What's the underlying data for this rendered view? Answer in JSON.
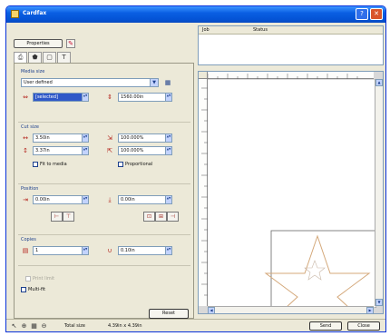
{
  "window": {
    "title": "Cardfax"
  },
  "hint": "",
  "left": {
    "properties_label": "Properties",
    "tabs": [
      {
        "name": "tab-print",
        "glyph": "🖶"
      },
      {
        "name": "tab-shape",
        "glyph": "⬟"
      },
      {
        "name": "tab-frame",
        "glyph": "▢"
      },
      {
        "name": "tab-text",
        "glyph": "T"
      }
    ],
    "media": {
      "label": "Media size",
      "select_value": "User defined",
      "width_value": "[selected]",
      "height_value": "1560.00in"
    },
    "cutsize": {
      "label": "Cut size",
      "width_value": "3.50in",
      "width_pct": "100.000%",
      "height_value": "3.37in",
      "height_pct": "100.000%",
      "fit_label": "Fit to media",
      "proportional_label": "Proportional"
    },
    "position": {
      "label": "Position",
      "x_value": "0.00in",
      "y_value": "0.00in"
    },
    "copies": {
      "label": "Copies",
      "count_value": "1",
      "spacing_value": "0.10in"
    },
    "print_limit_label": "Print limit",
    "multi_label": "Multi-fit",
    "reset_label": "Reset"
  },
  "list": {
    "col1": "Job",
    "col2": "Status"
  },
  "status": {
    "text1": "Total size",
    "text2": "4.39in x 4.39in",
    "send_label": "Send",
    "close_label": "Close"
  },
  "colors": {
    "accent": "#2f58c8",
    "titlebar": "#0a5fe3",
    "star": "#d4a87a"
  }
}
